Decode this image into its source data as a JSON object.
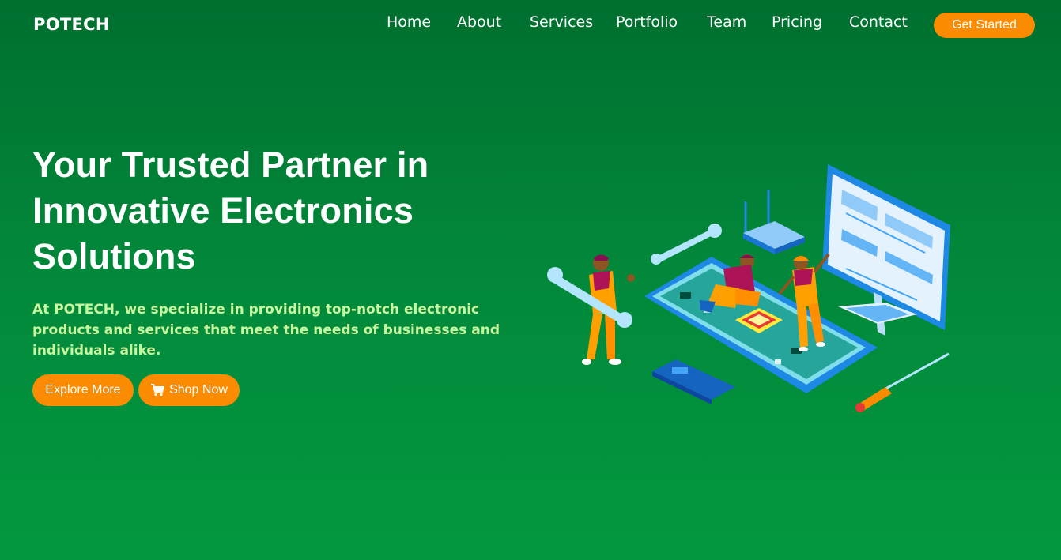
{
  "header": {
    "logo": "POTECH",
    "nav": [
      "Home",
      "About",
      "Services",
      "Portfolio",
      "Team",
      "Pricing",
      "Contact"
    ],
    "cta_label": "Get Started"
  },
  "hero": {
    "title_lines": [
      "Your Trusted Partner in",
      "Innovative Electronics",
      "Solutions"
    ],
    "description": "At POTECH, we specialize in providing top-notch electronic products and services that meet the needs of businesses and individuals alike.",
    "explore_label": "Explore More",
    "shop_label": "Shop Now",
    "shop_icon": "cart-icon"
  },
  "illustration": {
    "icon": "electronics-repair-illustration"
  },
  "colors": {
    "accent": "#fb8b00",
    "background_top": "#006f2f",
    "background_bottom": "#03983f",
    "description_text": "#c9f7a0"
  }
}
